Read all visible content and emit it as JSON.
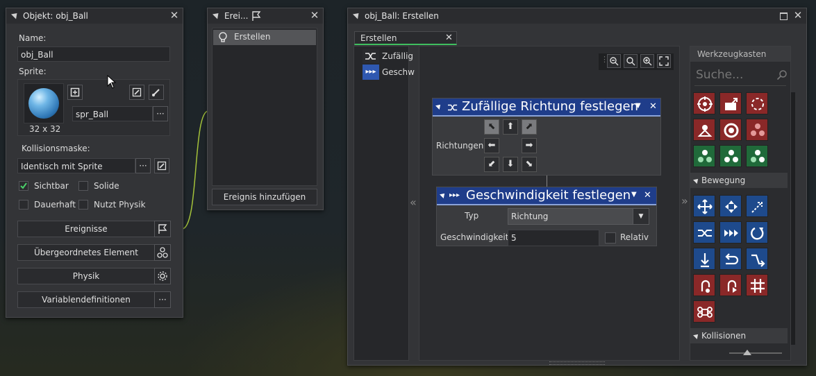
{
  "object_window": {
    "title": "Objekt: obj_Ball",
    "name_label": "Name:",
    "name_value": "obj_Ball",
    "sprite_label": "Sprite:",
    "sprite_name": "spr_Ball",
    "sprite_size": "32 x 32",
    "collision_label": "Kollisionsmaske:",
    "collision_value": "Identisch mit Sprite",
    "checkboxes": [
      {
        "label": "Sichtbar",
        "checked": true
      },
      {
        "label": "Solide",
        "checked": false
      },
      {
        "label": "Dauerhaft",
        "checked": false
      },
      {
        "label": "Nutzt Physik",
        "checked": false
      }
    ],
    "buttons": [
      "Ereignisse",
      "Übergeordnetes Element",
      "Physik",
      "Variablendefinitionen"
    ],
    "ellipsis": "···"
  },
  "events_window": {
    "title": "Erei...",
    "items": [
      "Erstellen"
    ],
    "add_button": "Ereignis hinzufügen"
  },
  "code_window": {
    "title": "obj_Ball: Erstellen",
    "tab": "Erstellen",
    "list_items": [
      "Zufällig",
      "Geschw"
    ],
    "collapse_left": "«",
    "collapse_right": "»",
    "action1": {
      "title": "Zufällige Richtung festlegen",
      "param_label": "Richtungen"
    },
    "action2": {
      "title": "Geschwindigkeit festlegen",
      "type_label": "Typ",
      "type_value": "Richtung",
      "speed_label": "Geschwindigkeit",
      "speed_value": "5",
      "relative_label": "Relativ"
    }
  },
  "toolbox": {
    "title": "Werkzeugkasten",
    "search_placeholder": "Suche...",
    "section_movement": "Bewegung",
    "section_collisions": "Kollisionen"
  },
  "colors": {
    "accent_blue": "#1f3d8a",
    "tile_red": "#8a2828",
    "tile_green": "#206a3a",
    "tab_green": "#3fbf5f"
  }
}
